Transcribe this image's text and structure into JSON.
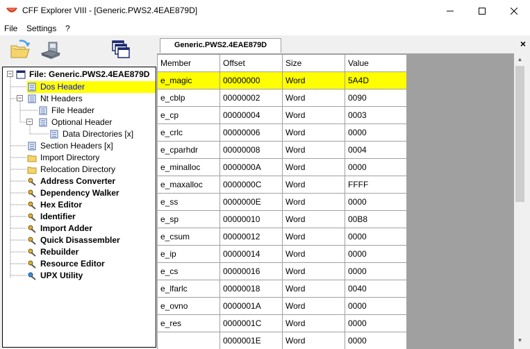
{
  "window": {
    "title": "CFF Explorer VIII - [Generic.PWS2.4EAE879D]"
  },
  "menu": {
    "items": [
      "File",
      "Settings",
      "?"
    ]
  },
  "toolbar": {
    "buttons": [
      "open-folder-icon",
      "save-disk-icon",
      "windows-icon"
    ]
  },
  "tree": {
    "root": "File: Generic.PWS2.4EAE879D",
    "nodes": [
      {
        "label": "Dos Header",
        "selected": true
      },
      {
        "label": "Nt Headers"
      },
      {
        "label": "File Header"
      },
      {
        "label": "Optional Header"
      },
      {
        "label": "Data Directories [x]"
      },
      {
        "label": "Section Headers [x]"
      },
      {
        "label": "Import Directory"
      },
      {
        "label": "Relocation Directory"
      },
      {
        "label": "Address Converter"
      },
      {
        "label": "Dependency Walker"
      },
      {
        "label": "Hex Editor"
      },
      {
        "label": "Identifier"
      },
      {
        "label": "Import Adder"
      },
      {
        "label": "Quick Disassembler"
      },
      {
        "label": "Rebuilder"
      },
      {
        "label": "Resource Editor"
      },
      {
        "label": "UPX Utility"
      }
    ]
  },
  "tab": {
    "label": "Generic.PWS2.4EAE879D",
    "close": "×"
  },
  "grid": {
    "columns": [
      "Member",
      "Offset",
      "Size",
      "Value"
    ],
    "rows": [
      [
        "e_magic",
        "00000000",
        "Word",
        "5A4D"
      ],
      [
        "e_cblp",
        "00000002",
        "Word",
        "0090"
      ],
      [
        "e_cp",
        "00000004",
        "Word",
        "0003"
      ],
      [
        "e_crlc",
        "00000006",
        "Word",
        "0000"
      ],
      [
        "e_cparhdr",
        "00000008",
        "Word",
        "0004"
      ],
      [
        "e_minalloc",
        "0000000A",
        "Word",
        "0000"
      ],
      [
        "e_maxalloc",
        "0000000C",
        "Word",
        "FFFF"
      ],
      [
        "e_ss",
        "0000000E",
        "Word",
        "0000"
      ],
      [
        "e_sp",
        "00000010",
        "Word",
        "00B8"
      ],
      [
        "e_csum",
        "00000012",
        "Word",
        "0000"
      ],
      [
        "e_ip",
        "00000014",
        "Word",
        "0000"
      ],
      [
        "e_cs",
        "00000016",
        "Word",
        "0000"
      ],
      [
        "e_lfarlc",
        "00000018",
        "Word",
        "0040"
      ],
      [
        "e_ovno",
        "0000001A",
        "Word",
        "0000"
      ],
      [
        "e_res",
        "0000001C",
        "Word",
        "0000"
      ],
      [
        "",
        "0000001E",
        "Word",
        "0000"
      ]
    ]
  },
  "colors": {
    "highlight": "#ffff00",
    "selection_text": "#0000ff"
  }
}
